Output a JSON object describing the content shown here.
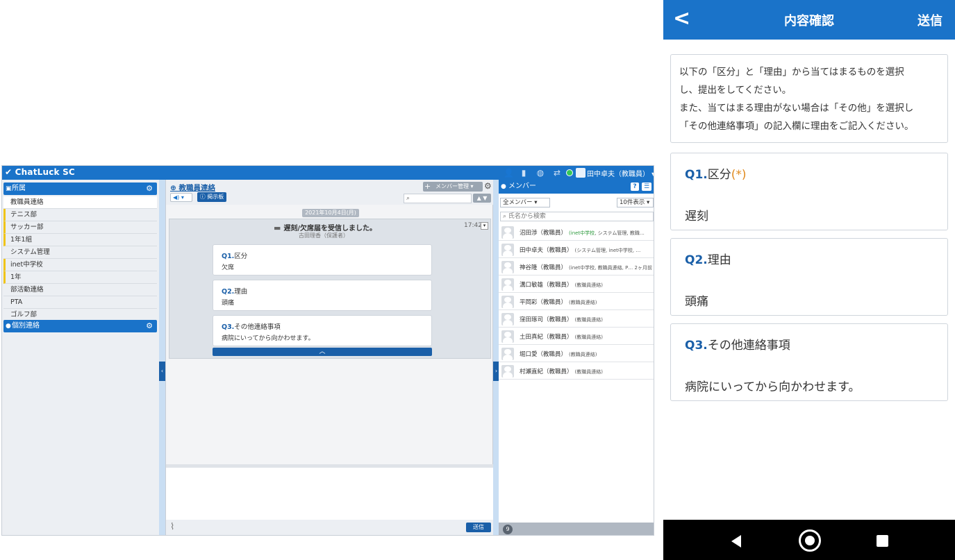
{
  "desktop": {
    "app_name": "ChatLuck SC",
    "user_name": "田中卓夫（教職員）",
    "sidebar": {
      "section1": "所属",
      "items": [
        {
          "label": "教職員連絡",
          "selected": true,
          "marked": false
        },
        {
          "label": "テニス部",
          "selected": false,
          "marked": true
        },
        {
          "label": "サッカー部",
          "selected": false,
          "marked": true
        },
        {
          "label": "1年1組",
          "selected": false,
          "marked": true
        },
        {
          "label": "システム管理",
          "selected": false,
          "marked": false
        },
        {
          "label": "inet中学校",
          "selected": false,
          "marked": true
        },
        {
          "label": "1年",
          "selected": false,
          "marked": true
        },
        {
          "label": "部活動連絡",
          "selected": false,
          "marked": false
        },
        {
          "label": "PTA",
          "selected": false,
          "marked": false
        },
        {
          "label": "ゴルフ部",
          "selected": false,
          "marked": false
        }
      ],
      "section2": "個別連絡"
    },
    "center": {
      "room_title": "教職員連絡",
      "board_button": "掲示板",
      "member_manage": "メンバー管理",
      "date": "2021年10月4日(月)",
      "message_title": "遅刻/欠席届を受信しました。",
      "sender": "古田理香（保護者）",
      "time": "17:42",
      "cards": [
        {
          "num": "Q1.",
          "label": "区分",
          "answer": "欠席"
        },
        {
          "num": "Q2.",
          "label": "理由",
          "answer": "頭痛"
        },
        {
          "num": "Q3.",
          "label": "その他連絡事項",
          "answer": "病院にいってから向かわせます。"
        }
      ],
      "send_button": "送信"
    },
    "members": {
      "title": "メンバー",
      "filter": "全メンバー",
      "per_page": "10件表示",
      "search_placeholder": "氏名から検索",
      "rows": [
        {
          "name": "沼田渉（教職員）",
          "detail_green": "(inet中学校",
          "detail": ", システム管理, 教職…"
        },
        {
          "name": "田中卓夫（教職員）",
          "detail_green": "",
          "detail": "(システム管理, inet中学校, …"
        },
        {
          "name": "神谷隆（教職員）",
          "detail_green": "",
          "detail": "(inet中学校, 教職員連絡, P… 2ヶ月前"
        },
        {
          "name": "溝口敏雄（教職員）",
          "detail_green": "",
          "detail": "(教職員連絡)"
        },
        {
          "name": "平岡彩（教職員）",
          "detail_green": "",
          "detail": "(教職員連絡)"
        },
        {
          "name": "窪田琢司（教職員）",
          "detail_green": "",
          "detail": "(教職員連絡)"
        },
        {
          "name": "土田真紀（教職員）",
          "detail_green": "",
          "detail": "(教職員連絡)"
        },
        {
          "name": "堀口愛（教職員）",
          "detail_green": "",
          "detail": "(教職員連絡)"
        },
        {
          "name": "村瀬直紀（教職員）",
          "detail_green": "",
          "detail": "(教職員連絡)"
        }
      ],
      "count": "9"
    }
  },
  "mobile": {
    "title": "内容確認",
    "send": "送信",
    "back_glyph": "〈",
    "intro_lines": [
      "以下の「区分」と「理由」から当てはまるものを選択",
      "し、提出をしてください。",
      "また、当てはまる理由がない場合は「その他」を選択し",
      "「その他連絡事項」の記入欄に理由をご記入ください。"
    ],
    "questions": [
      {
        "num": "Q1.",
        "label": "区分",
        "required": "(*)",
        "answer": "遅刻"
      },
      {
        "num": "Q2.",
        "label": "理由",
        "required": "",
        "answer": "頭痛"
      },
      {
        "num": "Q3.",
        "label": "その他連絡事項",
        "required": "",
        "answer": "病院にいってから向かわせます。"
      }
    ]
  },
  "colors": {
    "accent": "#1a73c9",
    "dark_accent": "#1a5fa8",
    "required": "#e08a1e"
  }
}
